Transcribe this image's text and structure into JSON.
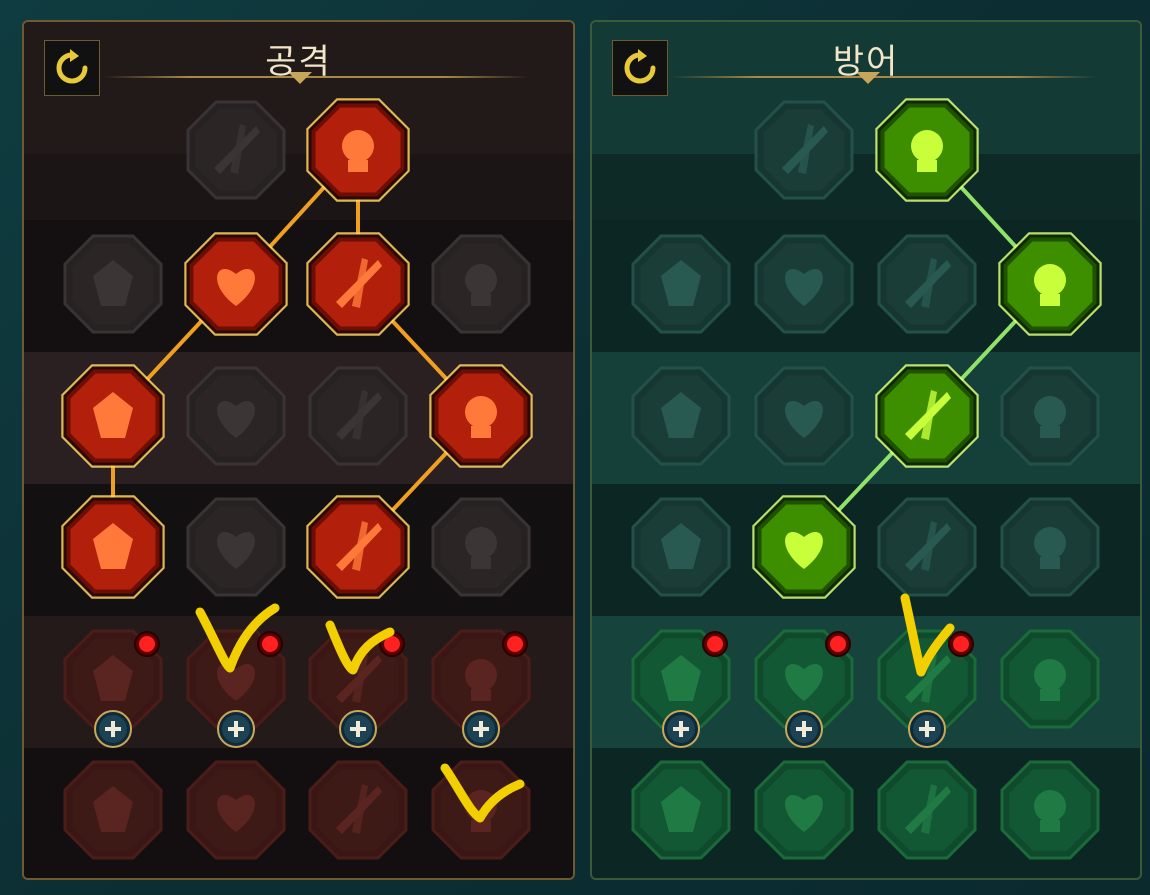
{
  "panels": {
    "attack": {
      "title": "공격",
      "theme": {
        "accent": "#ff6a2a",
        "active_fill": "#b2200c",
        "glow": "#ffd560"
      }
    },
    "defense": {
      "title": "방어",
      "theme": {
        "accent": "#a8ff2a",
        "active_fill": "#3d8f00",
        "glow": "#d9ff7a"
      }
    }
  },
  "talents": {
    "attack": [
      [
        "crossed-swords-icon",
        "inactive"
      ],
      [
        "sword-burst-icon",
        "active"
      ],
      [
        "horned-demon-icon",
        "inactive"
      ],
      [
        "speed-slash-icon",
        "active"
      ],
      [
        "shield-strike-icon",
        "active"
      ],
      [
        "thorned-heart-icon",
        "inactive"
      ],
      [
        "arrow-volley-icon",
        "active"
      ],
      [
        "fang-maw-icon",
        "inactive"
      ],
      [
        "skull-cloak-icon",
        "inactive"
      ],
      [
        "dagger-hand-icon",
        "active"
      ],
      [
        "bleeding-heart-icon",
        "active"
      ],
      [
        "iron-fist-icon",
        "inactive"
      ],
      [
        "axe-slam-icon",
        "active"
      ],
      [
        "chain-lightning-icon",
        "inactive"
      ],
      [
        "arrow-rain-icon",
        "locked"
      ],
      [
        "flaming-skull-icon",
        "locked"
      ],
      [
        "sun-spear-icon",
        "locked"
      ],
      [
        "lightning-man-icon",
        "locked"
      ],
      [
        "sparkle-strike-icon",
        "locked"
      ],
      [
        "helm-lightning-icon",
        "locked"
      ],
      [
        "horned-warrior-icon",
        "locked"
      ],
      [
        "burning-skull-icon",
        "locked"
      ]
    ],
    "defense": [
      [
        "armor-plates-icon",
        "inactive"
      ],
      [
        "raised-fist-icon",
        "active"
      ],
      [
        "shroud-icon",
        "inactive"
      ],
      [
        "heart-shield-icon",
        "inactive"
      ],
      [
        "stone-golem-icon",
        "inactive"
      ],
      [
        "crossed-blades-icon",
        "active"
      ],
      [
        "crowd-cheer-icon",
        "inactive"
      ],
      [
        "knight-shield-icon",
        "inactive"
      ],
      [
        "skull-heart-icon",
        "active"
      ],
      [
        "meditation-icon",
        "inactive"
      ],
      [
        "rallying-crowd-icon",
        "inactive"
      ],
      [
        "hourglass-icon",
        "active"
      ],
      [
        "open-palm-icon",
        "inactive"
      ],
      [
        "bull-head-icon",
        "inactive"
      ],
      [
        "charge-runner-icon",
        "locked"
      ],
      [
        "roots-icon",
        "locked"
      ],
      [
        "skull-aura-icon",
        "locked"
      ],
      [
        "grab-hand-icon",
        "locked"
      ],
      [
        "crowned-hero-icon",
        "locked"
      ],
      [
        "winged-shield-icon",
        "locked"
      ],
      [
        "shouting-warrior-icon",
        "locked"
      ],
      [
        "strongman-icon",
        "locked"
      ]
    ]
  },
  "upgrade_buttons": {
    "attack": 4,
    "defense": 3
  },
  "notification_badges": {
    "attack": 4,
    "defense": 3
  },
  "annotation_color": "#f2cf00"
}
